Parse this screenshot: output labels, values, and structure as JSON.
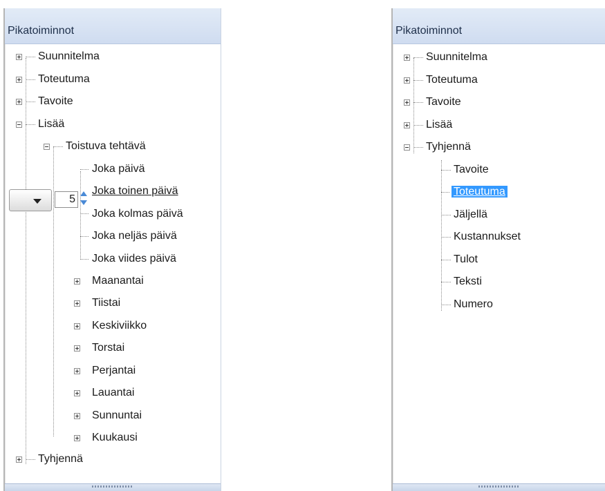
{
  "left_panel": {
    "title": "Pikatoiminnot",
    "tree": {
      "suunnitelma": "Suunnitelma",
      "toteutuma": "Toteutuma",
      "tavoite": "Tavoite",
      "lisaa": "Lisää",
      "toistuva_tehtava": "Toistuva tehtävä",
      "joka_paiva": "Joka päivä",
      "joka_toinen_paiva": "Joka toinen päivä",
      "joka_kolmas_paiva": "Joka kolmas päivä",
      "joka_neljas_paiva": "Joka neljäs päivä",
      "joka_viides_paiva": "Joka viides päivä",
      "maanantai": "Maanantai",
      "tiistai": "Tiistai",
      "keskiviikko": "Keskiviikko",
      "torstai": "Torstai",
      "perjantai": "Perjantai",
      "lauantai": "Lauantai",
      "sunnuntai": "Sunnuntai",
      "kuukausi": "Kuukausi",
      "tyhjenna": "Tyhjennä"
    },
    "inline_control": {
      "number_value": "5"
    }
  },
  "right_panel": {
    "title": "Pikatoiminnot",
    "tree": {
      "suunnitelma": "Suunnitelma",
      "toteutuma": "Toteutuma",
      "tavoite": "Tavoite",
      "lisaa": "Lisää",
      "tyhjenna": "Tyhjennä",
      "tavoite_child": "Tavoite",
      "toteutuma_child": "Toteutuma",
      "jaljella": "Jäljellä",
      "kustannukset": "Kustannukset",
      "tulot": "Tulot",
      "teksti": "Teksti",
      "numero": "Numero"
    },
    "selected_item": "Toteutuma"
  },
  "colors": {
    "header_bg": "#d8e3f3",
    "selection": "#3399ff",
    "spinner_arrows": "#4a8ad6"
  }
}
